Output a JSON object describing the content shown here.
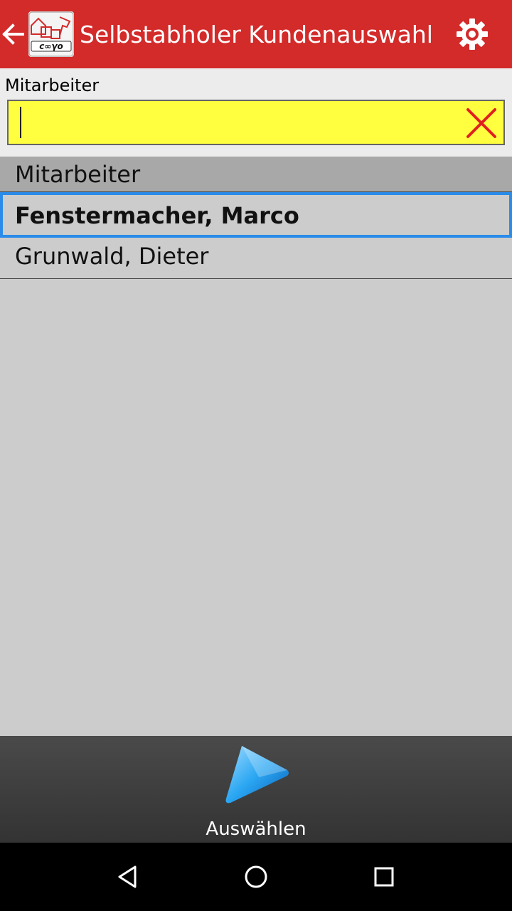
{
  "appbar": {
    "title": "Selbstabholer Kundenauswahl",
    "icons": {
      "back": "arrow-left-icon",
      "logo": "app-logo-icon",
      "settings": "gear-icon"
    },
    "color": "#d32a2a"
  },
  "field": {
    "label": "Mitarbeiter",
    "value": "",
    "placeholder": "",
    "clear_icon": "close-icon",
    "background": "#ffff3f"
  },
  "list": {
    "header": "Mitarbeiter",
    "items": [
      {
        "label": "Fenstermacher, Marco",
        "selected": true
      },
      {
        "label": "Grunwald, Dieter",
        "selected": false
      }
    ],
    "selection_color": "#2a8be9"
  },
  "action": {
    "label": "Auswählen",
    "icon": "play-icon"
  },
  "navbar": {
    "icons": [
      "back-triangle-icon",
      "home-circle-icon",
      "recents-square-icon"
    ]
  }
}
